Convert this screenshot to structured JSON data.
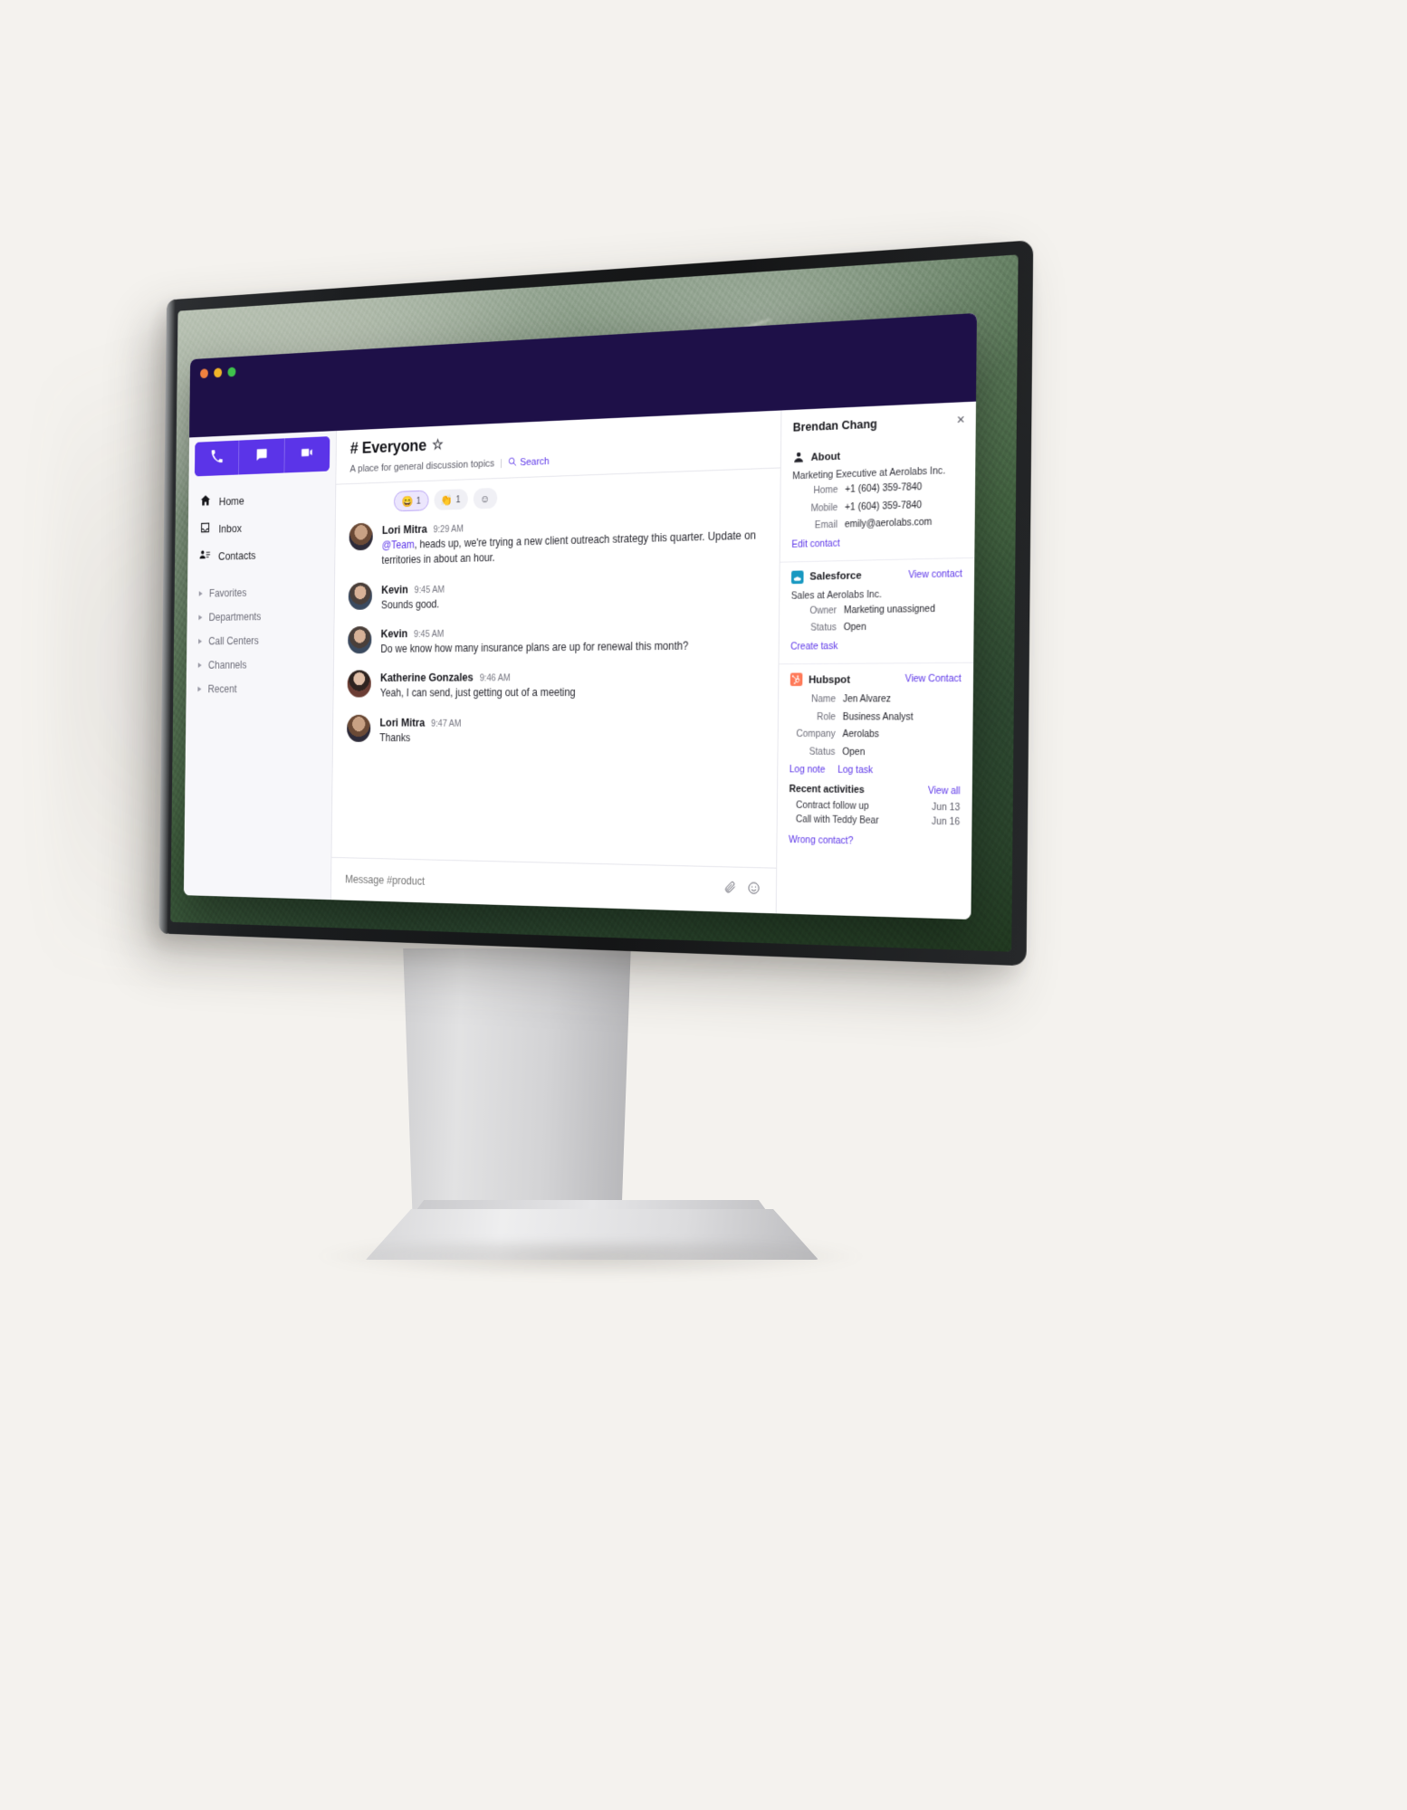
{
  "window": {
    "traffic_lights": [
      "close",
      "minimize",
      "maximize"
    ]
  },
  "mode_tabs": [
    {
      "name": "phone",
      "icon": "phone-icon"
    },
    {
      "name": "messages",
      "icon": "chat-icon"
    },
    {
      "name": "video",
      "icon": "video-icon"
    }
  ],
  "sidebar": {
    "nav": [
      {
        "label": "Home",
        "icon": "home-icon"
      },
      {
        "label": "Inbox",
        "icon": "inbox-icon"
      },
      {
        "label": "Contacts",
        "icon": "contacts-icon"
      }
    ],
    "sections": [
      {
        "label": "Favorites"
      },
      {
        "label": "Departments"
      },
      {
        "label": "Call Centers"
      },
      {
        "label": "Channels"
      },
      {
        "label": "Recent"
      }
    ]
  },
  "channel": {
    "title": "# Everyone",
    "star": "☆",
    "description": "A place for general discussion topics",
    "separator": "|",
    "search_label": "Search"
  },
  "reactions": [
    {
      "emoji": "😄",
      "count": "1",
      "active": true
    },
    {
      "emoji": "👏",
      "count": "1",
      "active": false
    },
    {
      "emoji": "☺",
      "count": "",
      "active": false
    }
  ],
  "messages": [
    {
      "author": "Lori Mitra",
      "time": "9:29 AM",
      "mention": "@Team",
      "text": ", heads up, we're trying a new client outreach strategy this quarter. Update on territories in about an hour.",
      "avatar_color": "#8d6b55"
    },
    {
      "author": "Kevin",
      "time": "9:45 AM",
      "mention": "",
      "text": "Sounds good.",
      "avatar_color": "#6f7f92"
    },
    {
      "author": "Kevin",
      "time": "9:45 AM",
      "mention": "",
      "text": "Do we know how many insurance plans are up for renewal this month?",
      "avatar_color": "#6f7f92"
    },
    {
      "author": "Katherine Gonzales",
      "time": "9:46 AM",
      "mention": "",
      "text": "Yeah, I can send, just getting out of a meeting",
      "avatar_color": "#7a5a4c"
    },
    {
      "author": "Lori Mitra",
      "time": "9:47 AM",
      "mention": "",
      "text": "Thanks",
      "avatar_color": "#8d6b55"
    }
  ],
  "composer": {
    "placeholder": "Message #product",
    "attach_icon": "paperclip-icon",
    "emoji_icon": "smiley-icon"
  },
  "contact_panel": {
    "name": "Brendan Chang",
    "close": "×",
    "about": {
      "title": "About",
      "icon": "person-icon",
      "headline": "Marketing Executive at Aerolabs Inc.",
      "fields": [
        {
          "key": "Home",
          "value": "+1 (604) 359-7840"
        },
        {
          "key": "Mobile",
          "value": "+1 (604) 359-7840"
        },
        {
          "key": "Email",
          "value": "emily@aerolabs.com"
        }
      ],
      "action": "Edit contact"
    },
    "salesforce": {
      "title": "Salesforce",
      "icon": "salesforce-cloud-icon",
      "link": "View contact",
      "headline": "Sales at Aerolabs Inc.",
      "fields": [
        {
          "key": "Owner",
          "value": "Marketing unassigned"
        },
        {
          "key": "Status",
          "value": "Open"
        }
      ],
      "action": "Create task"
    },
    "hubspot": {
      "title": "Hubspot",
      "icon": "hubspot-icon",
      "link": "View Contact",
      "fields": [
        {
          "key": "Name",
          "value": "Jen Alvarez"
        },
        {
          "key": "Role",
          "value": "Business Analyst"
        },
        {
          "key": "Company",
          "value": "Aerolabs"
        },
        {
          "key": "Status",
          "value": "Open"
        }
      ],
      "actions": [
        "Log note",
        "Log task"
      ],
      "recent": {
        "title": "Recent activities",
        "link": "View all",
        "items": [
          {
            "label": "Contract follow up",
            "date": "Jun 13"
          },
          {
            "label": "Call with Teddy Bear",
            "date": "Jun 16"
          }
        ]
      },
      "footer": "Wrong contact?"
    }
  },
  "colors": {
    "brand_purple": "#5b34e8",
    "titlebar": "#1e1048",
    "page_bg": "#f4f2ee"
  }
}
